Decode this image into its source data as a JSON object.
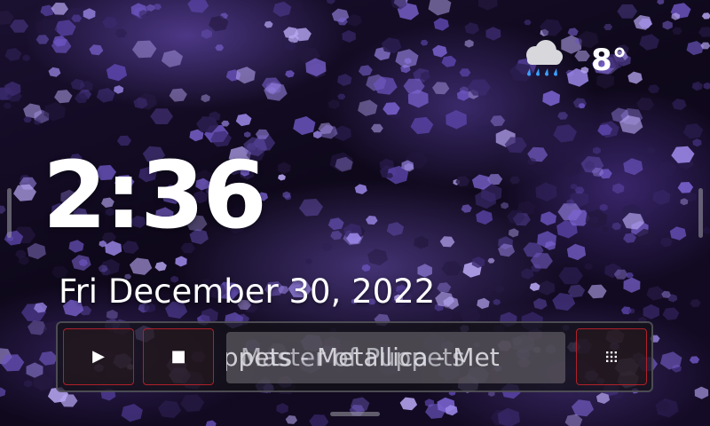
{
  "weather": {
    "icon": "rain-cloud-icon",
    "temperature": "8°"
  },
  "clock": {
    "time": "2:36",
    "date": "Fri December 30, 2022"
  },
  "media": {
    "play_glyph": "▶",
    "stop_glyph": "■",
    "menu_icon": "grid-dots-icon",
    "now_playing_fragment_a": "uppets - Metallica - Met",
    "now_playing_fragment_b": "Master of Puppets"
  },
  "colors": {
    "accent_border": "#b0202a",
    "text": "#ffffff",
    "rain": "#3aa0ff"
  }
}
